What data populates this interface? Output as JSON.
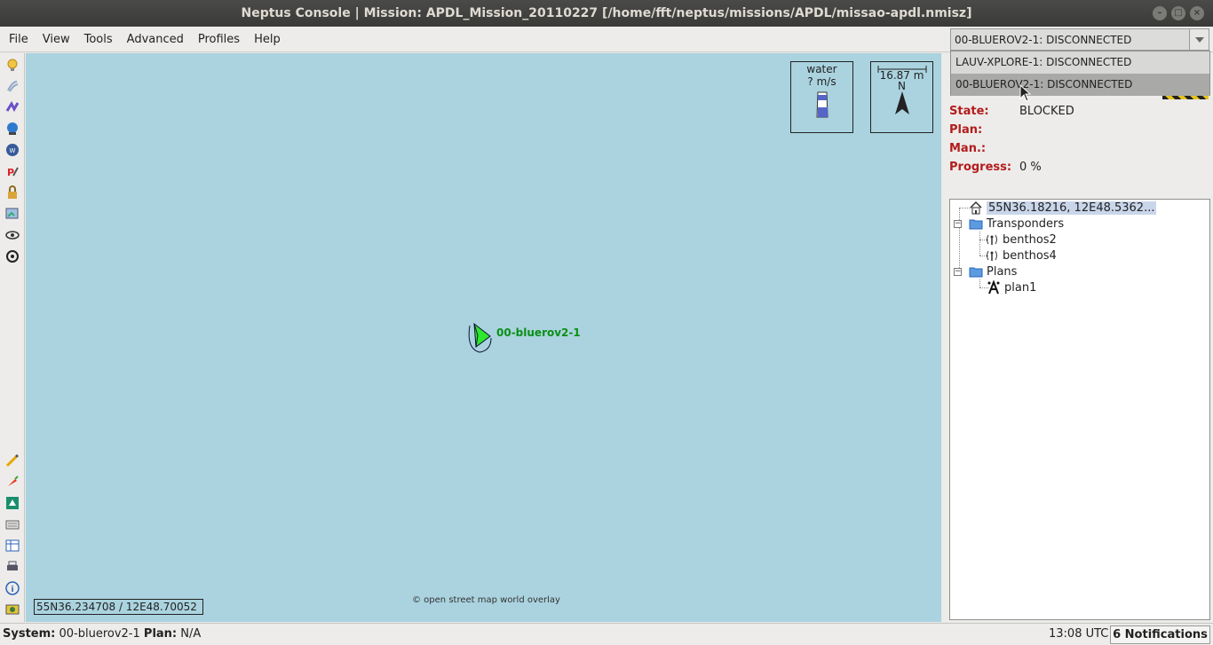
{
  "window": {
    "title": "Neptus Console | Mission: APDL_Mission_20110227 [/home/fft/neptus/missions/APDL/missao-apdl.nmisz]"
  },
  "menu": [
    "File",
    "View",
    "Tools",
    "Advanced",
    "Profiles",
    "Help"
  ],
  "system_selector": {
    "selected": "00-BLUEROV2-1: DISCONNECTED",
    "options": [
      "LAUV-XPLORE-1: DISCONNECTED",
      "00-BLUEROV2-1: DISCONNECTED"
    ]
  },
  "map": {
    "water_widget": {
      "label": "water",
      "speed": "? m/s"
    },
    "scale_widget": {
      "distance": "16.87 m",
      "north": "N"
    },
    "vehicle_label": "00-bluerov2-1",
    "attribution": "© open street map world overlay",
    "cursor_coords": "55N36.234708 / 12E48.70052"
  },
  "vehicle_info": {
    "state_label": "State:",
    "state_value": "BLOCKED",
    "plan_label": "Plan:",
    "plan_value": "",
    "man_label": "Man.:",
    "man_value": "",
    "progress_label": "Progress:",
    "progress_value": "0 %"
  },
  "mission_tree": {
    "home": "55N36.18216, 12E48.5362...",
    "transponders_label": "Transponders",
    "transponders": [
      "benthos2",
      "benthos4"
    ],
    "plans_label": "Plans",
    "plans": [
      "plan1"
    ]
  },
  "statusbar": {
    "system_label": "System:",
    "system_value": "00-bluerov2-1",
    "plan_label": "Plan:",
    "plan_value": "N/A",
    "time": "13:08 UTC",
    "notifications": "6 Notifications"
  },
  "colors": {
    "map_water": "#aad3df",
    "label_red": "#b31c1c",
    "vehicle_green": "#2ee82e"
  }
}
